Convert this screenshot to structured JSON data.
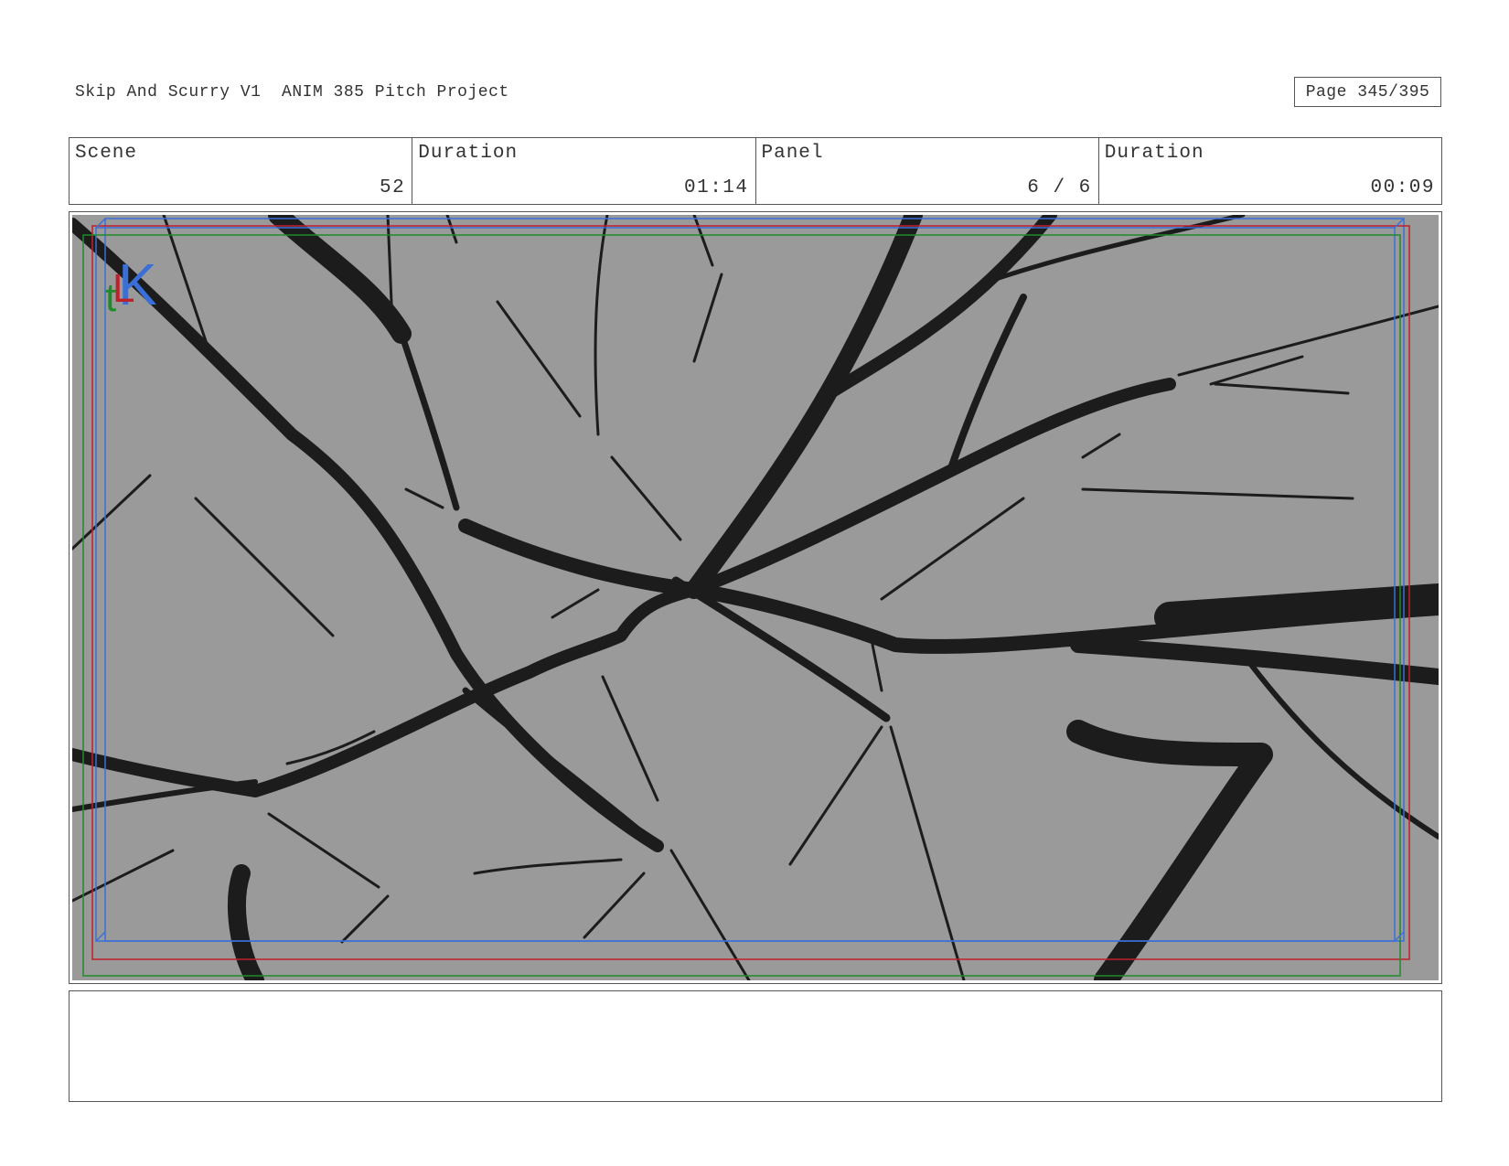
{
  "header": {
    "title": "Skip And Scurry V1  ANIM 385 Pitch Project",
    "page": "Page 345/395"
  },
  "info": {
    "scene_label": "Scene",
    "scene_value": "52",
    "scene_duration_label": "Duration",
    "scene_duration_value": "01:14",
    "panel_label": "Panel",
    "panel_value": "6 / 6",
    "panel_duration_label": "Duration",
    "panel_duration_value": "00:09"
  },
  "panel": {
    "background_color": "#9a9a9a",
    "branch_color": "#1c1c1c",
    "guide_colors": [
      "#3a6fd8",
      "#c0202a",
      "#1f8a2a"
    ]
  },
  "notes": {
    "text": ""
  }
}
